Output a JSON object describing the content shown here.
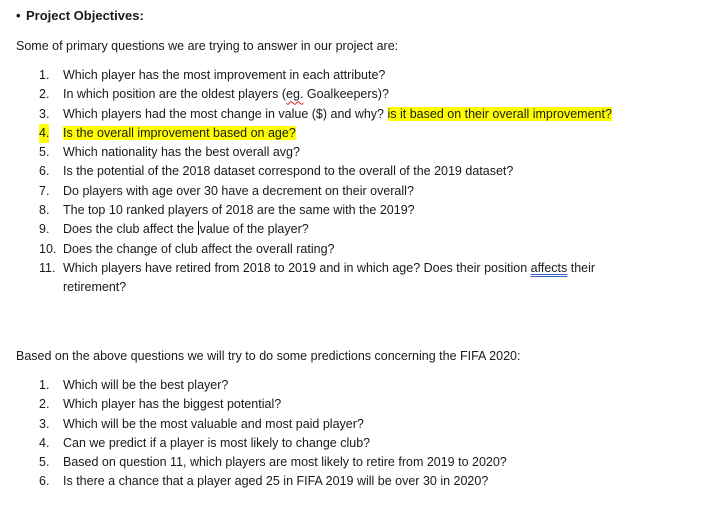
{
  "heading": {
    "bullet": "•",
    "title": "Project Objectives:"
  },
  "intro": "Some of primary questions we are trying to answer in our project are:",
  "questions": [
    {
      "num": "1.",
      "text": "Which player has the most improvement in each attribute?"
    },
    {
      "num": "2.",
      "pre": "In which position are the oldest players (",
      "flag": "eg.",
      "post": " Goalkeepers)?"
    },
    {
      "num": "3.",
      "text": "Which players had the most change in value ($) and why?",
      "highlight": "is it based on their overall improvement?"
    },
    {
      "num": "4.",
      "text": "Is the overall improvement based on age?"
    },
    {
      "num": "5.",
      "text": "Which nationality has the best overall avg?"
    },
    {
      "num": "6.",
      "text": "Is the potential of the 2018 dataset correspond to the overall of the 2019 dataset?"
    },
    {
      "num": "7.",
      "text": "Do players with age over 30 have a decrement on their overall?"
    },
    {
      "num": "8.",
      "text": "The top 10 ranked players of 2018 are the same with the 2019?"
    },
    {
      "num": "9.",
      "pre": "Does the club affect the ",
      "post": "value of the player?"
    },
    {
      "num": "10.",
      "text": "Does the change of club affect the overall rating?"
    },
    {
      "num": "11.",
      "pre": "Which players have retired from 2018 to 2019 and in which age? Does their position ",
      "flag": "affects",
      "post": " their retirement?"
    }
  ],
  "predictions_intro": "Based on the above questions we will try to do some predictions concerning the FIFA 2020:",
  "predictions": [
    {
      "num": "1.",
      "text": "Which will be the best player?"
    },
    {
      "num": "2.",
      "text": "Which player has the biggest potential?"
    },
    {
      "num": "3.",
      "text": "Which will be the most valuable and most paid player?"
    },
    {
      "num": "4.",
      "text": "Can we predict if a player is most likely to change club?"
    },
    {
      "num": "5.",
      "text": "Based on question 11, which players are most likely to retire from 2019 to 2020?"
    },
    {
      "num": "6.",
      "text": "Is there a chance that a player aged 25 in FIFA 2019 will be over 30 in 2020?"
    }
  ],
  "colors": {
    "highlight": "#ffff00",
    "spelling_underline": "#d22222",
    "grammar_underline": "#3a5fc9"
  }
}
